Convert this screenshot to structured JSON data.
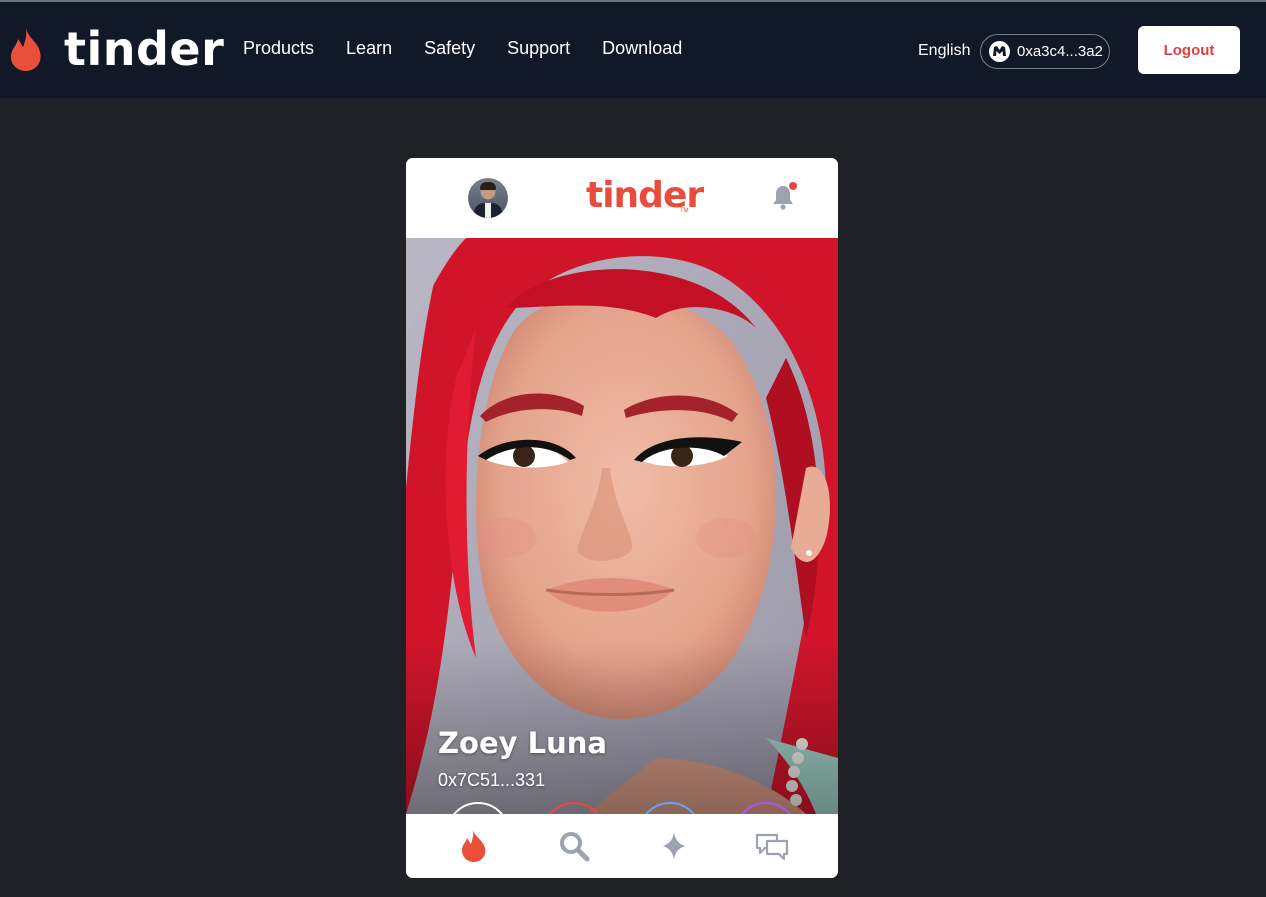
{
  "navbar": {
    "brand": "tinder",
    "links": [
      "Products",
      "Learn",
      "Safety",
      "Support",
      "Download"
    ],
    "language": "English",
    "wallet_address": "0xa3c4...3a2",
    "logout_label": "Logout"
  },
  "card": {
    "header_logo": "tinder",
    "header_logo_tm": "TM",
    "profile": {
      "name": "Zoey Luna",
      "address": "0x7C51...331"
    },
    "actions": [
      "rewind-icon",
      "close-icon",
      "star-icon",
      "lightning-icon"
    ],
    "bottom_tabs": [
      "flame-icon",
      "search-icon",
      "diamond-icon",
      "chat-bubbles-icon"
    ]
  },
  "colors": {
    "navbar_bg": "#111827",
    "page_bg": "#202126",
    "brand_red": "#e84c3d",
    "logout_text": "#e53e3e",
    "nope": "#ef4444",
    "super_like": "#60a5fa",
    "boost": "#a855f7"
  }
}
